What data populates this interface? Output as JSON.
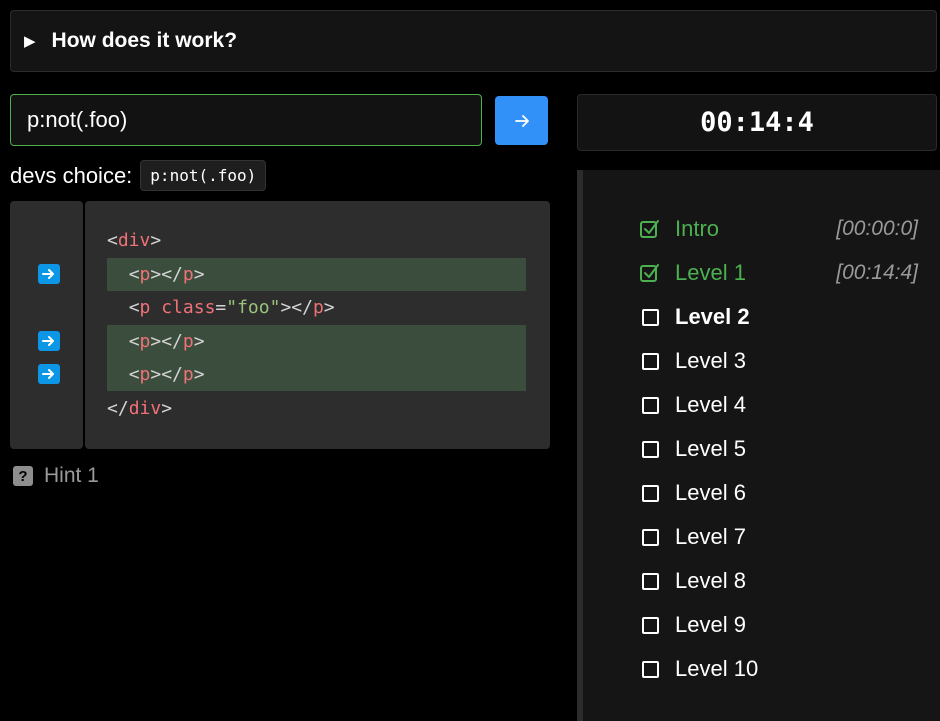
{
  "details": {
    "title": "How does it work?"
  },
  "selector": {
    "value": "p:not(.foo)",
    "submit_icon": "arrow-right-icon"
  },
  "timer": "00:14:4",
  "devs_choice": {
    "label": "devs choice:",
    "code": "p:not(.foo)"
  },
  "code_lines": [
    {
      "indent": "",
      "parts": [
        [
          "pun",
          "<"
        ],
        [
          "tag",
          "div"
        ],
        [
          "pun",
          ">"
        ]
      ],
      "highlight": false,
      "arrow": false
    },
    {
      "indent": "  ",
      "parts": [
        [
          "pun",
          "<"
        ],
        [
          "tag",
          "p"
        ],
        [
          "pun",
          "></"
        ],
        [
          "tag",
          "p"
        ],
        [
          "pun",
          ">"
        ]
      ],
      "highlight": true,
      "arrow": true
    },
    {
      "indent": "  ",
      "parts": [
        [
          "pun",
          "<"
        ],
        [
          "tag",
          "p"
        ],
        [
          "pun",
          " "
        ],
        [
          "attr",
          "class"
        ],
        [
          "pun",
          "="
        ],
        [
          "str",
          "\"foo\""
        ],
        [
          "pun",
          "></"
        ],
        [
          "tag",
          "p"
        ],
        [
          "pun",
          ">"
        ]
      ],
      "highlight": false,
      "arrow": false
    },
    {
      "indent": "  ",
      "parts": [
        [
          "pun",
          "<"
        ],
        [
          "tag",
          "p"
        ],
        [
          "pun",
          "></"
        ],
        [
          "tag",
          "p"
        ],
        [
          "pun",
          ">"
        ]
      ],
      "highlight": true,
      "arrow": true
    },
    {
      "indent": "  ",
      "parts": [
        [
          "pun",
          "<"
        ],
        [
          "tag",
          "p"
        ],
        [
          "pun",
          "></"
        ],
        [
          "tag",
          "p"
        ],
        [
          "pun",
          ">"
        ]
      ],
      "highlight": true,
      "arrow": true
    },
    {
      "indent": "",
      "parts": [
        [
          "pun",
          "</"
        ],
        [
          "tag",
          "div"
        ],
        [
          "pun",
          ">"
        ]
      ],
      "highlight": false,
      "arrow": false
    }
  ],
  "hint": {
    "label": "Hint 1",
    "icon": "question-icon"
  },
  "levels": [
    {
      "label": "Intro",
      "status": "done",
      "time": "[00:00:0]"
    },
    {
      "label": "Level 1",
      "status": "done",
      "time": "[00:14:4]"
    },
    {
      "label": "Level 2",
      "status": "current",
      "time": ""
    },
    {
      "label": "Level 3",
      "status": "todo",
      "time": ""
    },
    {
      "label": "Level 4",
      "status": "todo",
      "time": ""
    },
    {
      "label": "Level 5",
      "status": "todo",
      "time": ""
    },
    {
      "label": "Level 6",
      "status": "todo",
      "time": ""
    },
    {
      "label": "Level 7",
      "status": "todo",
      "time": ""
    },
    {
      "label": "Level 8",
      "status": "todo",
      "time": ""
    },
    {
      "label": "Level 9",
      "status": "todo",
      "time": ""
    },
    {
      "label": "Level 10",
      "status": "todo",
      "time": ""
    }
  ],
  "colors": {
    "accent": "#3291f8",
    "success": "#4caf50",
    "highlight": "#3b4d3c"
  }
}
